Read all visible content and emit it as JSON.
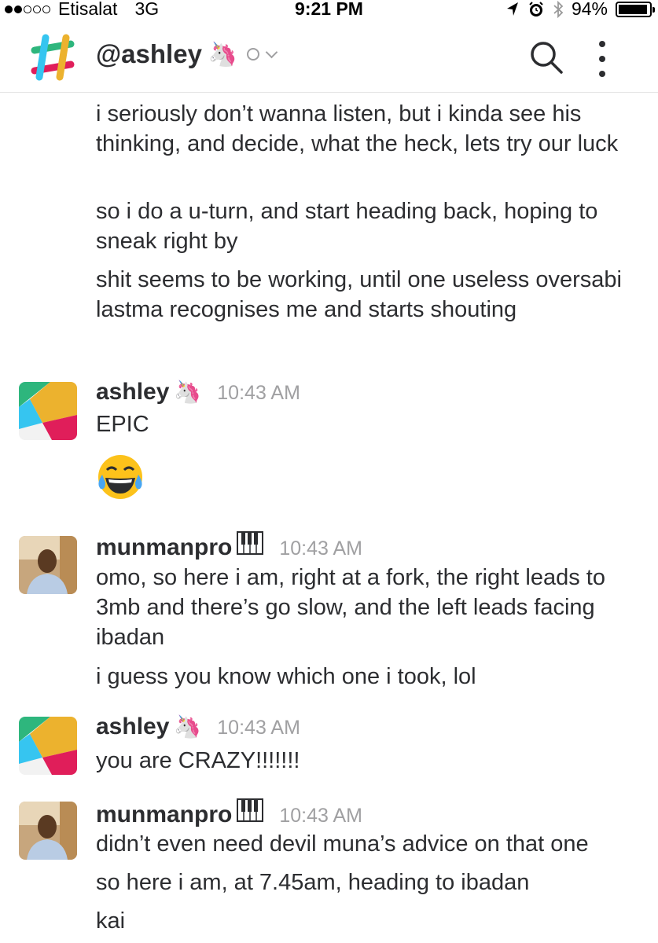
{
  "status_bar": {
    "carrier": "Etisalat",
    "network": "3G",
    "time": "9:21 PM",
    "battery": "94%",
    "battery_level": 0.94,
    "icons": [
      "location-arrow-icon",
      "alarm-icon",
      "bluetooth-icon",
      "battery-icon"
    ]
  },
  "header": {
    "channel": "@ashley",
    "channel_emoji": "🦄",
    "icons": [
      "slack-logo",
      "search-icon",
      "more-vertical-icon",
      "presence-icon",
      "chevron-down-icon"
    ]
  },
  "messages": [
    {
      "text": "i seriously don’t wanna listen, but i kinda see his thinking, and decide, what the heck, lets try our luck"
    },
    {
      "text": "so i do a u-turn, and start heading back, hoping to sneak right by"
    },
    {
      "text": "shit seems to be working, until one useless oversabi lastma recognises me and starts shouting"
    }
  ],
  "groups": [
    {
      "author": "ashley",
      "author_emoji": "🦄",
      "time": "10:43 AM",
      "lines": [
        "EPIC"
      ],
      "reaction_emoji": "😂"
    },
    {
      "author": "munmanpro",
      "author_emoji": "🎹",
      "time": "10:43 AM",
      "lines": [
        "omo, so here i am, right at a fork, the right leads to 3mb and there’s go slow, and the left leads facing ibadan",
        "i guess you know which one i took, lol"
      ]
    },
    {
      "author": "ashley",
      "author_emoji": "🦄",
      "time": "10:43 AM",
      "lines": [
        "you are CRAZY!!!!!!!"
      ]
    },
    {
      "author": "munmanpro",
      "author_emoji": "🎹",
      "time": "10:43 AM",
      "lines": [
        "didn’t even need devil muna’s advice on that one",
        "so here i am, at 7.45am, heading to ibadan",
        "kai"
      ]
    }
  ],
  "colors": {
    "slack_blue": "#36c5f0",
    "slack_green": "#2eb67d",
    "slack_yellow": "#ecb22e",
    "slack_red": "#e01e5a",
    "timestamp": "#a0a0a2"
  }
}
